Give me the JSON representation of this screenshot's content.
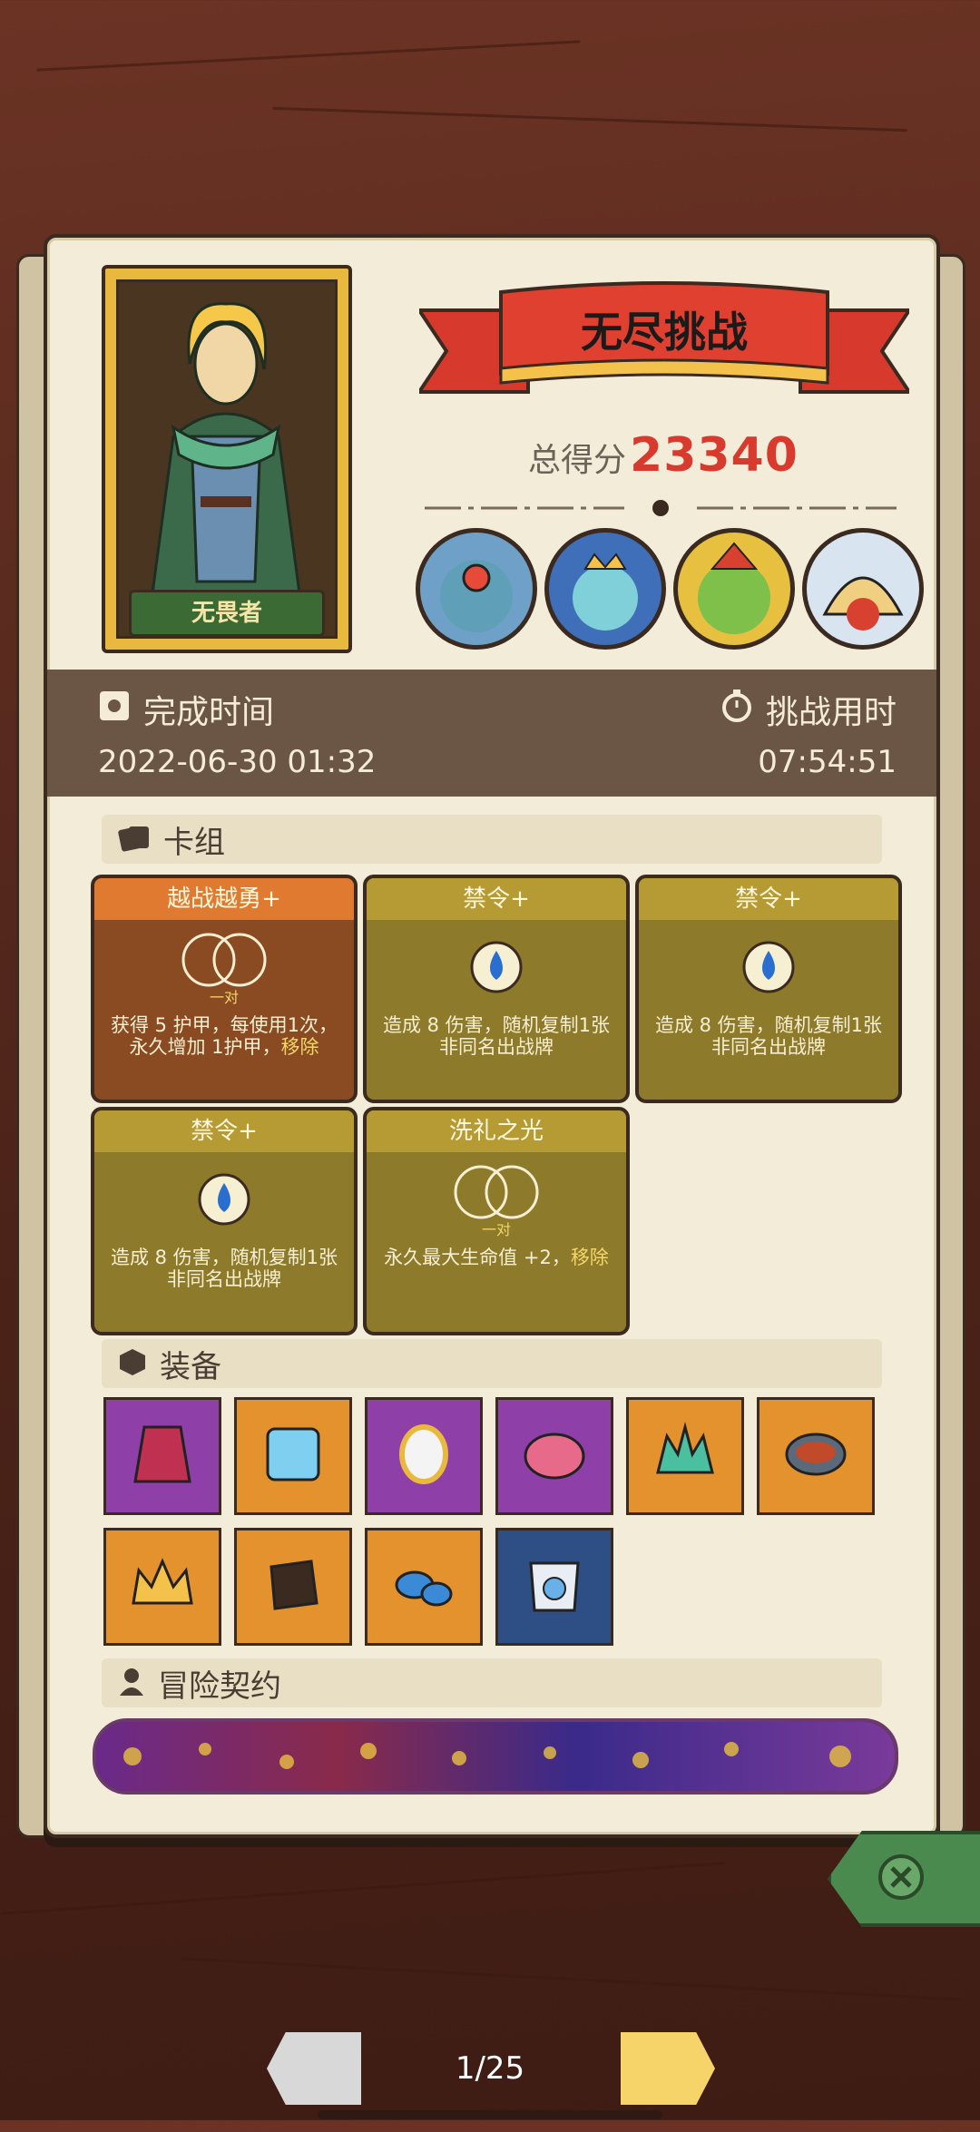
{
  "mode_title": "无尽挑战",
  "score": {
    "label": "总得分",
    "value": "23340"
  },
  "hero": {
    "name": "无畏者"
  },
  "time": {
    "completion_label": "完成时间",
    "completion_value": "2022-06-30 01:32",
    "duration_label": "挑战用时",
    "duration_value": "07:54:51"
  },
  "deck": {
    "title": "卡组",
    "cards": [
      {
        "name": "越战越勇+",
        "sub": "一对",
        "desc": "获得 5 护甲，每使用1次，永久增加 1护甲，",
        "desc2": "移除",
        "style": "brown",
        "icon": "double-ring-icon"
      },
      {
        "name": "禁令+",
        "sub": "",
        "desc": "造成 8 伤害，随机复制1张非同名出战牌",
        "desc2": "",
        "style": "olive",
        "icon": "water-drop-icon"
      },
      {
        "name": "禁令+",
        "sub": "",
        "desc": "造成 8 伤害，随机复制1张非同名出战牌",
        "desc2": "",
        "style": "olive",
        "icon": "water-drop-icon"
      },
      {
        "name": "禁令+",
        "sub": "",
        "desc": "造成 8 伤害，随机复制1张非同名出战牌",
        "desc2": "",
        "style": "olive",
        "icon": "water-drop-icon"
      },
      {
        "name": "洗礼之光",
        "sub": "一对",
        "desc": "永久最大生命值 +2，",
        "desc2": "移除",
        "style": "olive",
        "icon": "double-ring-icon"
      }
    ]
  },
  "equipment": {
    "title": "装备",
    "items": [
      {
        "icon": "armor-vest-icon",
        "bg": "purple"
      },
      {
        "icon": "ice-cube-icon",
        "bg": "orange"
      },
      {
        "icon": "mirror-icon",
        "bg": "purple"
      },
      {
        "icon": "mushroom-cap-icon",
        "bg": "purple"
      },
      {
        "icon": "flame-crown-icon",
        "bg": "orange"
      },
      {
        "icon": "bowl-icon",
        "bg": "orange"
      },
      {
        "icon": "gold-crown-icon",
        "bg": "orange"
      },
      {
        "icon": "dark-gauntlet-icon",
        "bg": "orange"
      },
      {
        "icon": "blue-mushrooms-icon",
        "bg": "orange"
      },
      {
        "icon": "compass-chestplate-icon",
        "bg": "blue"
      }
    ]
  },
  "contract": {
    "title": "冒险契约"
  },
  "pager": {
    "text": "1/25"
  },
  "colors": {
    "score": "#d83a2e",
    "timebar": "#6b5646",
    "close": "#4b8a4e"
  }
}
